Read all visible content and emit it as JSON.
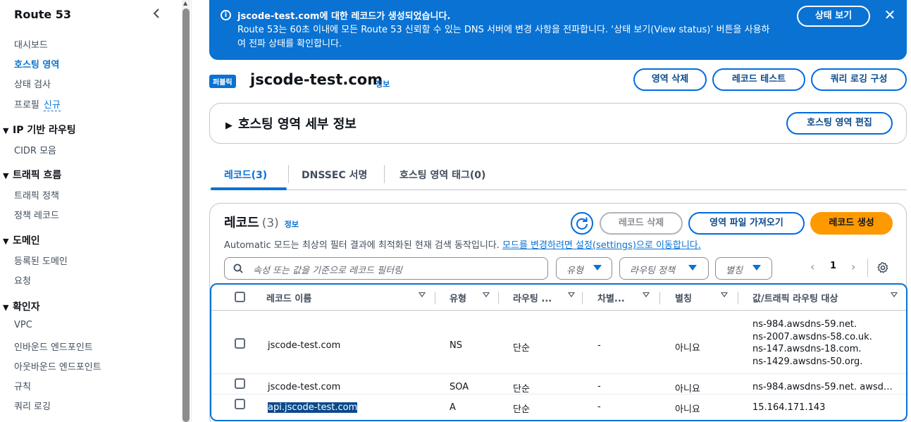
{
  "sidebar": {
    "title": "Route 53",
    "items_top": [
      {
        "label": "대시보드"
      },
      {
        "label": "호스팅 영역"
      },
      {
        "label": "상태 검사"
      },
      {
        "label": "프로필",
        "badge": "신규"
      }
    ],
    "sections": [
      {
        "title": "IP 기반 라우팅",
        "items": [
          "CIDR 모음"
        ]
      },
      {
        "title": "트래픽 흐름",
        "items": [
          "트래픽 정책",
          "정책 레코드"
        ]
      },
      {
        "title": "도메인",
        "items": [
          "등록된 도메인",
          "요청"
        ]
      },
      {
        "title": "확인자",
        "items": [
          "VPC",
          "인바운드 엔드포인트",
          "아웃바운드 엔드포인트",
          "규칙",
          "쿼리 로깅"
        ]
      }
    ]
  },
  "flash": {
    "title": "jscode-test.com에 대한 레코드가 생성되었습니다.",
    "body": "Route 53는 60초 이내에 모든 Route 53 신뢰할 수 있는 DNS 서버에 변경 사항을 전파합니다. ‘상태 보기(View status)’ 버튼을 사용하여 전파 상태를 확인합니다.",
    "button": "상태 보기"
  },
  "header": {
    "badge": "퍼블릭",
    "title": "jscode-test.com",
    "info": "정보",
    "actions": [
      "영역 삭제",
      "레코드 테스트",
      "쿼리 로깅 구성"
    ]
  },
  "details": {
    "title": "호스팅 영역 세부 정보",
    "edit_button": "호스팅 영역 편집"
  },
  "tabs": [
    "레코드(3)",
    "DNSSEC 서명",
    "호스팅 영역 태그(0)"
  ],
  "records": {
    "title": "레코드",
    "count": "(3)",
    "info": "정보",
    "delete_button": "레코드 삭제",
    "import_button": "영역 파일 가져오기",
    "create_button": "레코드 생성",
    "desc": "Automatic 모드는 최상의 필터 결과에 최적화된 현재 검색 동작입니다.",
    "desc_link": "모드를 변경하려면 설정(settings)으로 이동합니다.",
    "search_placeholder": "속성 또는 값을 기준으로 레코드 필터링",
    "filters": [
      "유형",
      "라우팅 정책",
      "별칭"
    ],
    "page": "1",
    "columns": [
      "레코드 이름",
      "유형",
      "라우팅 ...",
      "차별...",
      "별칭",
      "값/트래픽 라우팅 대상"
    ],
    "rows": [
      {
        "name": "jscode-test.com",
        "type": "NS",
        "routing": "단순",
        "diff": "-",
        "alias": "아니요",
        "values": [
          "ns-984.awsdns-59.net.",
          "ns-2007.awsdns-58.co.uk.",
          "ns-147.awsdns-18.com.",
          "ns-1429.awsdns-50.org."
        ]
      },
      {
        "name": "jscode-test.com",
        "type": "SOA",
        "routing": "단순",
        "diff": "-",
        "alias": "아니요",
        "values": [
          "ns-984.awsdns-59.net. awsd…"
        ]
      },
      {
        "name": "api.jscode-test.com",
        "type": "A",
        "routing": "단순",
        "diff": "-",
        "alias": "아니요",
        "values": [
          "15.164.171.143"
        ]
      }
    ]
  }
}
